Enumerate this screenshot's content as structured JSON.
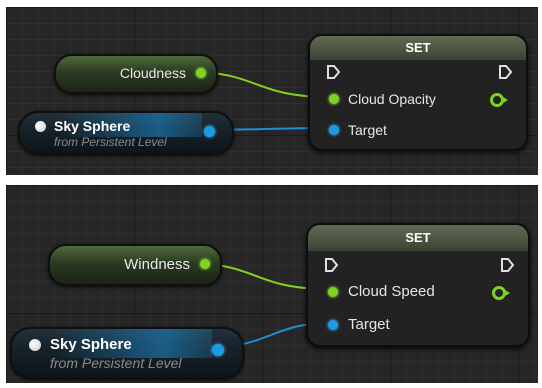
{
  "colors": {
    "float_pin": "#7ed321",
    "object_pin": "#1a9ce8",
    "float_wire": "#7ed321",
    "object_wire": "#1a8fd6",
    "background": "#262626"
  },
  "graphs": [
    {
      "variable_node": {
        "label": "Cloudness"
      },
      "reference_node": {
        "title": "Sky Sphere",
        "subtitle": "from Persistent Level"
      },
      "set_node": {
        "title": "SET",
        "value_pin_label": "Cloud Opacity",
        "target_pin_label": "Target"
      }
    },
    {
      "variable_node": {
        "label": "Windness"
      },
      "reference_node": {
        "title": "Sky Sphere",
        "subtitle": "from Persistent Level"
      },
      "set_node": {
        "title": "SET",
        "value_pin_label": "Cloud Speed",
        "target_pin_label": "Target"
      }
    }
  ]
}
